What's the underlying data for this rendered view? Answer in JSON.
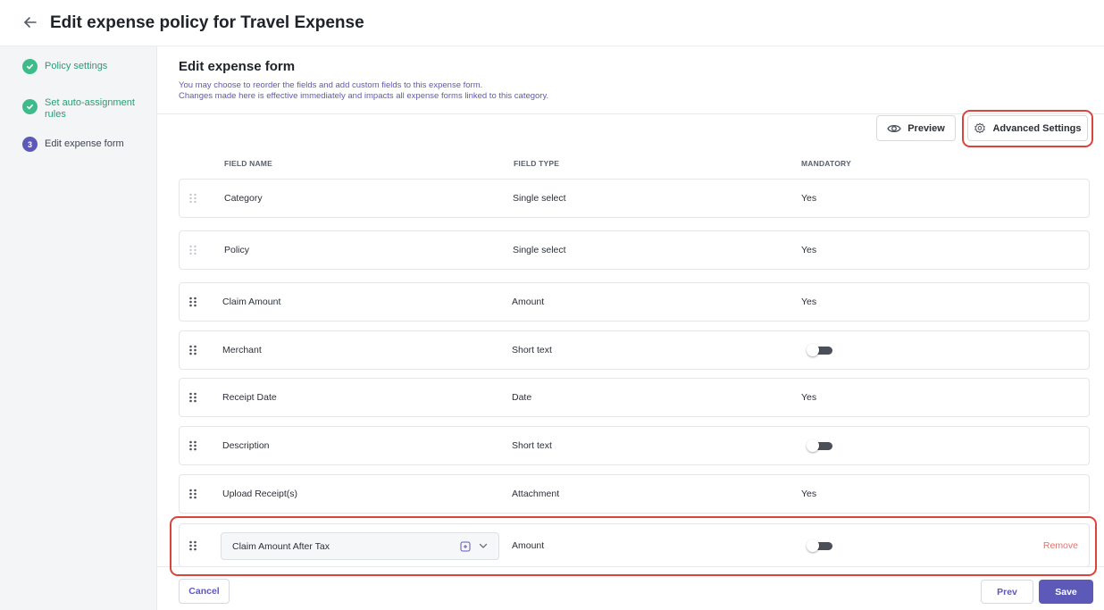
{
  "header": {
    "title": "Edit expense policy for Travel Expense"
  },
  "sidebar": {
    "steps": [
      {
        "label": "Policy settings",
        "state": "done"
      },
      {
        "label": "Set auto-assignment rules",
        "state": "done"
      },
      {
        "number": "3",
        "label": "Edit expense form",
        "state": "current"
      }
    ]
  },
  "form": {
    "title": "Edit expense form",
    "description_line1": "You may choose to reorder the fields and add custom fields to this expense form.",
    "description_line2": "Changes made here is effective immediately and impacts all expense forms linked to this category."
  },
  "toolbar": {
    "preview_label": "Preview",
    "advanced_settings_label": "Advanced Settings"
  },
  "table": {
    "columns": [
      "FIELD NAME",
      "FIELD TYPE",
      "MANDATORY"
    ],
    "rows": [
      {
        "name": "Category",
        "type": "Single select",
        "mandatory": "Yes"
      },
      {
        "name": "Policy",
        "type": "Single select",
        "mandatory": "Yes"
      },
      {
        "name": "Claim Amount",
        "type": "Amount",
        "mandatory": "Yes"
      },
      {
        "name": "Merchant",
        "type": "Short text",
        "mandatory": "toggle-off"
      },
      {
        "name": "Receipt Date",
        "type": "Date",
        "mandatory": "Yes"
      },
      {
        "name": "Description",
        "type": "Short text",
        "mandatory": "toggle-off"
      },
      {
        "name": "Upload Receipt(s)",
        "type": "Attachment",
        "mandatory": "Yes"
      }
    ],
    "custom_row": {
      "name": "Claim Amount After Tax",
      "type": "Amount",
      "mandatory": "toggle-off",
      "remove_label": "Remove"
    }
  },
  "footer": {
    "cancel_label": "Cancel",
    "prev_label": "Prev",
    "save_label": "Save"
  },
  "colors": {
    "accent": "#5d59b8",
    "success": "#3dbb8a",
    "highlight": "#d9453d",
    "danger_text": "#e8726c"
  },
  "icons": {
    "back": "arrow-left-icon",
    "done": "check-circle-icon",
    "preview": "eye-icon",
    "settings": "gear-icon",
    "drag": "drag-handle-icon",
    "custom_field": "custom-field-icon",
    "dropdown": "chevron-down-icon"
  }
}
